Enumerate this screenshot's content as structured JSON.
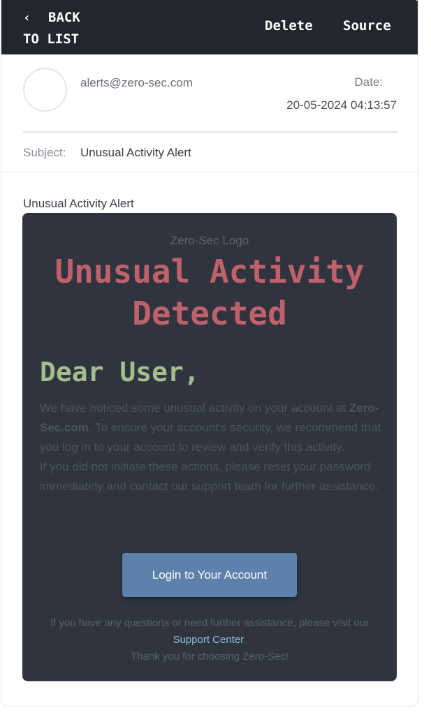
{
  "toolbar": {
    "back_line1": "BACK",
    "back_line2": "TO LIST",
    "back_chevron": "‹",
    "delete_label": "Delete",
    "source_label": "Source"
  },
  "header": {
    "from": "alerts@zero-sec.com",
    "date_label": "Date:",
    "date_value": "20-05-2024 04:13:57",
    "subject_label": "Subject:",
    "subject_value": "Unusual Activity Alert"
  },
  "preview": {
    "title": "Unusual Activity Alert"
  },
  "email": {
    "logo_alt": "Zero-Sec Logo",
    "headline_line1": "Unusual Activity",
    "headline_line2": "Detected",
    "greeting": "Dear User,",
    "para1_before": "We have noticed some unusual activity on your account at ",
    "para1_brand": "Zero-Sec.com",
    "para1_after": ". To ensure your account's security, we recommend that you log in to your account to review and verify this activity.",
    "para2": "If you did not initiate these actions, please reset your password immediately and contact our support team for further assistance.",
    "button_label": "Login to Your Account",
    "footer_before": "If you have any questions or need further assistance, please visit our",
    "footer_link": "Support Center",
    "footer_after": ".",
    "footer_thanks": "Thank you for choosing Zero-Sec!"
  },
  "colors": {
    "topbar": "#24262d",
    "card": "#2f343f",
    "headline": "#bf616a",
    "greeting": "#a3be8c",
    "button": "#5e81ac",
    "link": "#88c0d0"
  }
}
